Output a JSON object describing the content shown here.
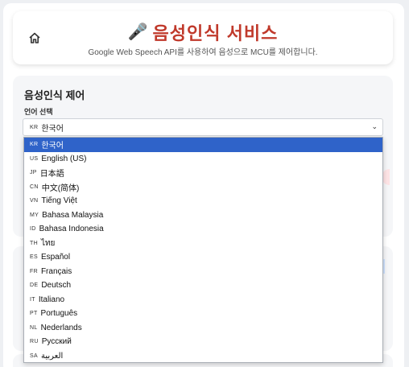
{
  "header": {
    "title": "음성인식 서비스",
    "subtitle": "Google Web Speech API를 사용하여 음성으로 MCU를 제어합니다."
  },
  "control": {
    "section_title": "음성인식 제어",
    "language_label": "언어 선택",
    "selected": {
      "code": "KR",
      "label": "한국어"
    }
  },
  "languages": [
    {
      "code": "KR",
      "label": "한국어",
      "selected": true
    },
    {
      "code": "US",
      "label": "English (US)"
    },
    {
      "code": "JP",
      "label": "日本語"
    },
    {
      "code": "CN",
      "label": "中文(简体)"
    },
    {
      "code": "VN",
      "label": "Tiếng Việt"
    },
    {
      "code": "MY",
      "label": "Bahasa Malaysia"
    },
    {
      "code": "ID",
      "label": "Bahasa Indonesia"
    },
    {
      "code": "TH",
      "label": "ไทย"
    },
    {
      "code": "ES",
      "label": "Español"
    },
    {
      "code": "FR",
      "label": "Français"
    },
    {
      "code": "DE",
      "label": "Deutsch"
    },
    {
      "code": "IT",
      "label": "Italiano"
    },
    {
      "code": "PT",
      "label": "Português"
    },
    {
      "code": "NL",
      "label": "Nederlands"
    },
    {
      "code": "RU",
      "label": "Русский"
    },
    {
      "code": "SA",
      "label": "العربية"
    }
  ],
  "icons": {
    "home": "home-icon",
    "mic": "microphone-icon",
    "chevron": "chevron-down-icon"
  },
  "colors": {
    "title": "#c0392b",
    "selected_option": "#2f63c9"
  }
}
